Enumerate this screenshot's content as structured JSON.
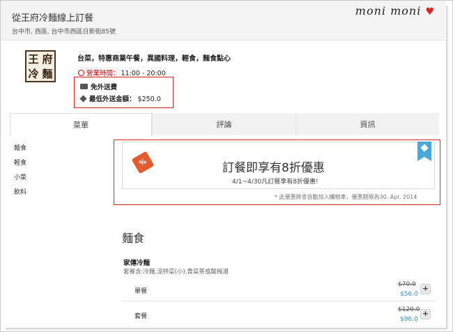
{
  "header": {
    "shop_title": "從王府冷麵線上訂餐",
    "address": "台中市, 西區, 台中市西區日新街85號",
    "watermark": "moni moni"
  },
  "logo": {
    "chars": [
      "王",
      "府",
      "冷",
      "麵"
    ]
  },
  "info": {
    "cuisine": "台菜，特惠商業午餐，異國料理，輕食，麵食點心",
    "hours_label": "營業時間：",
    "hours_value": "11:00 - 20:00",
    "free_delivery": "免外送費",
    "min_order_label": "最低外送金額：",
    "min_order_value": "$250.0"
  },
  "tabs": [
    {
      "label": "菜單"
    },
    {
      "label": "評論"
    },
    {
      "label": "資訊"
    }
  ],
  "categories": [
    "麵食",
    "輕食",
    "小菜",
    "飲料"
  ],
  "promo": {
    "tag_text": "%",
    "title": "訂餐即享有8折優惠",
    "subtitle": "4/1~4/30凡訂餐享有8折優惠!",
    "note": "* 此優惠將會自動加入購物車，優惠期限為30. Apr. 2014"
  },
  "section": {
    "title": "麵食",
    "dish_name": "家傳冷麵",
    "dish_desc": "套餐含:冷麵,涼拌菜(小),青菜茶或酸梅湯",
    "options": [
      {
        "label": "單餐",
        "old_price": "$70.0",
        "new_price": "$56.0"
      },
      {
        "label": "套餐",
        "old_price": "$120.0",
        "new_price": "$96.0"
      }
    ]
  },
  "add_label": "+"
}
